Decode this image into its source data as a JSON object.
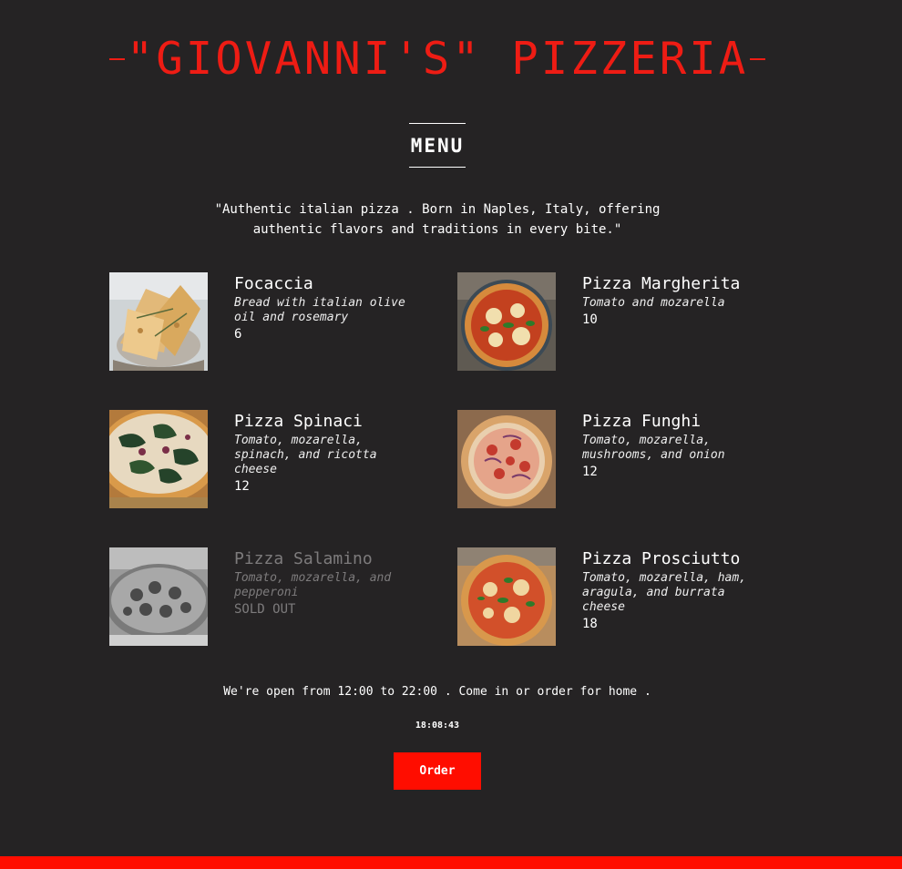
{
  "header": {
    "title": "\"GIOVANNI'S\" PIZZERIA"
  },
  "menu": {
    "title": "MENU"
  },
  "tagline": "\"Authentic italian pizza . Born in Naples, Italy, offering authentic flavors and traditions in every bite.\"",
  "items": [
    {
      "name": "Focaccia",
      "description": "Bread with italian olive oil and rosemary",
      "price": "6",
      "image": "focaccia-photo",
      "sold_out": false
    },
    {
      "name": "Pizza Margherita",
      "description": "Tomato and mozarella",
      "price": "10",
      "image": "pizza-margherita-photo",
      "sold_out": false
    },
    {
      "name": "Pizza Spinaci",
      "description": "Tomato, mozarella, spinach, and ricotta cheese",
      "price": "12",
      "image": "pizza-spinaci-photo",
      "sold_out": false
    },
    {
      "name": "Pizza Funghi",
      "description": "Tomato, mozarella, mushrooms, and onion",
      "price": "12",
      "image": "pizza-funghi-photo",
      "sold_out": false
    },
    {
      "name": "Pizza Salamino",
      "description": "Tomato, mozarella, and pepperoni",
      "price": "SOLD OUT",
      "image": "pizza-salamino-photo",
      "sold_out": true
    },
    {
      "name": "Pizza Prosciutto",
      "description": "Tomato, mozarella, ham, aragula, and burrata cheese",
      "price": "18",
      "image": "pizza-prosciutto-photo",
      "sold_out": false
    }
  ],
  "footer": {
    "hours_text": "We're open from 12:00 to 22:00 . Come in or order for home .",
    "clock": "18:08:43",
    "order_label": "Order"
  },
  "colors": {
    "accent": "#ee1c14",
    "button": "#ff0d00",
    "background": "#252324"
  }
}
